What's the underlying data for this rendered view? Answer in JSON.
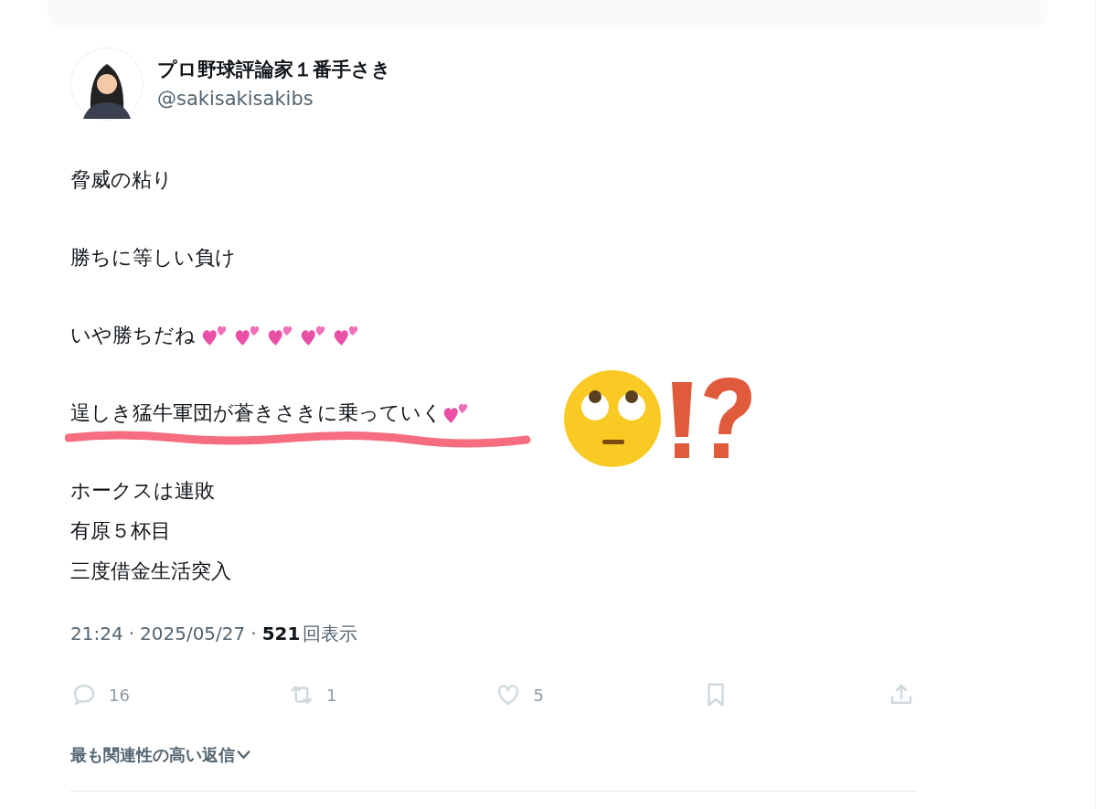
{
  "author": {
    "name": "プロ野球評論家１番手さき",
    "handle": "@sakisakisakibs"
  },
  "paragraphs": [
    {
      "lines": [
        {
          "text": "脅威の粘り",
          "kind": "plain",
          "underlined": false
        }
      ]
    },
    {
      "lines": [
        {
          "text": "勝ちに等しい負け",
          "kind": "plain",
          "underlined": false
        }
      ]
    },
    {
      "lines": [
        {
          "text": "いや勝ちだね",
          "kind": "hearts",
          "underlined": false
        }
      ]
    },
    {
      "lines": [
        {
          "text": "逞しき猛牛軍団が蒼きさきに乗っていく",
          "kind": "heart",
          "underlined": true
        }
      ]
    },
    {
      "lines": [
        {
          "text": "ホークスは連敗",
          "kind": "plain",
          "underlined": false
        },
        {
          "text": "有原５杯目",
          "kind": "plain",
          "underlined": false
        },
        {
          "text": "三度借金生活突入",
          "kind": "plain",
          "underlined": false
        }
      ]
    }
  ],
  "meta": {
    "time": "21:24",
    "separator": "·",
    "date": "2025/05/27",
    "separator_2": "·",
    "views": "521",
    "views_label": "回表示"
  },
  "actions": [
    {
      "kind": "reply",
      "count": "16"
    },
    {
      "kind": "retweet",
      "count": "1"
    },
    {
      "kind": "like",
      "count": "5"
    },
    {
      "kind": "bookmark"
    },
    {
      "kind": "share"
    }
  ],
  "sort": {
    "label": "最も関連性の高い返信"
  }
}
